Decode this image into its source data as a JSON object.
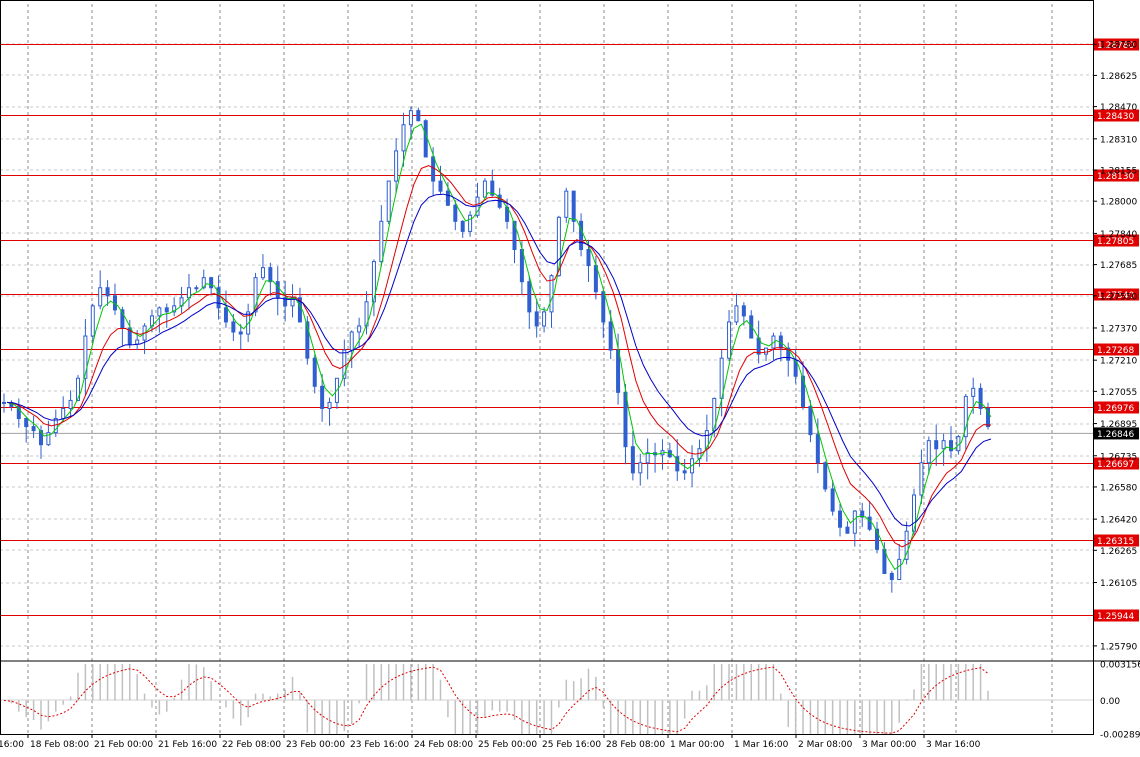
{
  "chart_data": {
    "type": "candlestick",
    "instrument_price_scale": {
      "ylim": [
        1.2572,
        1.2898
      ],
      "ticks": [
        "1.28780",
        "1.28625",
        "1.28470",
        "1.28310",
        "1.28155",
        "1.28000",
        "1.27840",
        "1.27685",
        "1.27530",
        "1.27370",
        "1.27210",
        "1.27055",
        "1.26895",
        "1.26735",
        "1.26580",
        "1.26420",
        "1.26265",
        "1.26105",
        "1.25790"
      ]
    },
    "x_tick_labels": [
      "16:00",
      "18 Feb 08:00",
      "21 Feb 00:00",
      "21 Feb 16:00",
      "22 Feb 08:00",
      "23 Feb 00:00",
      "23 Feb 16:00",
      "24 Feb 08:00",
      "25 Feb 00:00",
      "25 Feb 16:00",
      "28 Feb 08:00",
      "1 Mar 00:00",
      "1 Mar 16:00",
      "2 Mar 08:00",
      "3 Mar 00:00",
      "3 Mar 16:00"
    ],
    "levels": [
      {
        "label": "1.28780",
        "value": 1.2878
      },
      {
        "label": "1.28430",
        "value": 1.2843
      },
      {
        "label": "1.28130",
        "value": 1.2813
      },
      {
        "label": "1.27805",
        "value": 1.27805
      },
      {
        "label": "1.27540",
        "value": 1.2754
      },
      {
        "label": "1.27268",
        "value": 1.27268
      },
      {
        "label": "1.26976",
        "value": 1.26976
      },
      {
        "label": "1.26697",
        "value": 1.26697
      },
      {
        "label": "1.26315",
        "value": 1.26315
      },
      {
        "label": "1.25944",
        "value": 1.25944
      }
    ],
    "current_price": {
      "label": "1.26846",
      "value": 1.26846
    },
    "close_series": [
      1.27,
      1.2698,
      1.2692,
      1.2688,
      1.2686,
      1.2679,
      1.2685,
      1.2692,
      1.2697,
      1.2701,
      1.2712,
      1.2733,
      1.2748,
      1.2757,
      1.2753,
      1.2746,
      1.2737,
      1.2729,
      1.2731,
      1.2738,
      1.2743,
      1.2747,
      1.2745,
      1.2748,
      1.2752,
      1.2757,
      1.2757,
      1.2762,
      1.2757,
      1.2747,
      1.274,
      1.2735,
      1.2734,
      1.2745,
      1.2762,
      1.2767,
      1.276,
      1.2752,
      1.2748,
      1.2752,
      1.274,
      1.2722,
      1.2708,
      1.2697,
      1.27,
      1.2712,
      1.2726,
      1.2735,
      1.2738,
      1.275,
      1.277,
      1.279,
      1.281,
      1.2825,
      1.2838,
      1.2845,
      1.284,
      1.2822,
      1.281,
      1.2805,
      1.2798,
      1.279,
      1.2785,
      1.2793,
      1.2802,
      1.281,
      1.2803,
      1.2797,
      1.279,
      1.2776,
      1.276,
      1.2745,
      1.2738,
      1.2745,
      1.2763,
      1.2792,
      1.2805,
      1.279,
      1.2776,
      1.2768,
      1.2755,
      1.274,
      1.2726,
      1.2705,
      1.2678,
      1.2665,
      1.267,
      1.2675,
      1.2674,
      1.2676,
      1.2673,
      1.2666,
      1.2665,
      1.2672,
      1.2677,
      1.2686,
      1.2702,
      1.2722,
      1.274,
      1.2748,
      1.2743,
      1.2732,
      1.2724,
      1.2727,
      1.2733,
      1.2727,
      1.2721,
      1.2713,
      1.2698,
      1.2684,
      1.267,
      1.2657,
      1.2646,
      1.2638,
      1.2635,
      1.2646,
      1.2643,
      1.2637,
      1.2627,
      1.2615,
      1.2612,
      1.2622,
      1.2636,
      1.2654,
      1.267,
      1.2681,
      1.2677,
      1.2681,
      1.2676,
      1.2683,
      1.2703,
      1.2707,
      1.2697,
      1.2688
    ],
    "moving_averages": [
      {
        "color": "#00c800",
        "period": 8
      },
      {
        "color": "#e00000",
        "period": 21
      },
      {
        "color": "#0000c8",
        "period": 34
      }
    ],
    "oscillator": {
      "ylim": [
        -0.002891,
        0.003156
      ],
      "ticks": [
        "0.003156",
        "0.00",
        "-0.002891"
      ]
    }
  },
  "colors": {
    "bull": "#2f5fd0",
    "bear": "#2f5fd0",
    "level": "#e00000",
    "grid": "#8c8c8c",
    "histogram": "#c0c0c0",
    "signal": "#e00000",
    "current_price_bg": "#000000"
  }
}
